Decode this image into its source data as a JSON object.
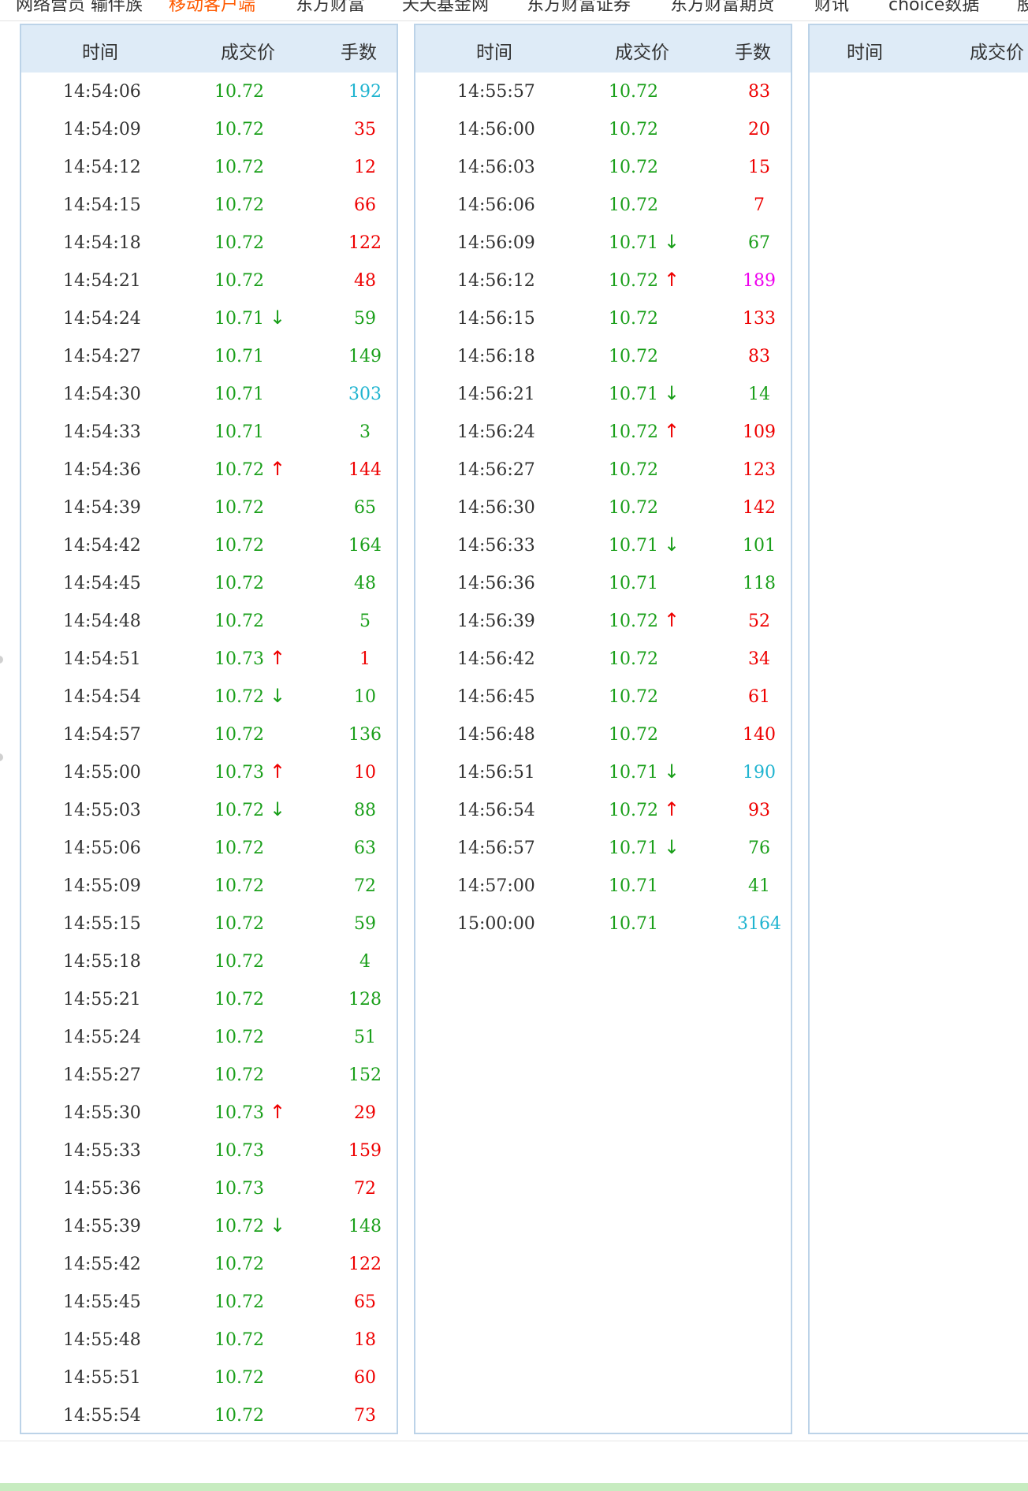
{
  "topnav": {
    "items": [
      "网络营员 输伴族",
      "移动客户端",
      "东方财富",
      "天天基金网",
      "东方财富证券",
      "东方财富期货",
      "财讯",
      "choice数据",
      "股"
    ]
  },
  "columns": {
    "time": "时间",
    "price": "成交价",
    "volume": "手数"
  },
  "colors": {
    "up": "#ee0000",
    "down": "#1a9f1a",
    "large": "#20b4d0",
    "huge": "#ee00ee",
    "header_bg": "#deebf7",
    "border": "#bcd3e8"
  },
  "panels": [
    {
      "rows": [
        {
          "time": "14:54:06",
          "price": "10.72",
          "arrow": "",
          "vol": "192",
          "vol_color": "cyan"
        },
        {
          "time": "14:54:09",
          "price": "10.72",
          "arrow": "",
          "vol": "35",
          "vol_color": "red"
        },
        {
          "time": "14:54:12",
          "price": "10.72",
          "arrow": "",
          "vol": "12",
          "vol_color": "red"
        },
        {
          "time": "14:54:15",
          "price": "10.72",
          "arrow": "",
          "vol": "66",
          "vol_color": "red"
        },
        {
          "time": "14:54:18",
          "price": "10.72",
          "arrow": "",
          "vol": "122",
          "vol_color": "red"
        },
        {
          "time": "14:54:21",
          "price": "10.72",
          "arrow": "",
          "vol": "48",
          "vol_color": "red"
        },
        {
          "time": "14:54:24",
          "price": "10.71",
          "arrow": "down",
          "vol": "59",
          "vol_color": "green"
        },
        {
          "time": "14:54:27",
          "price": "10.71",
          "arrow": "",
          "vol": "149",
          "vol_color": "green"
        },
        {
          "time": "14:54:30",
          "price": "10.71",
          "arrow": "",
          "vol": "303",
          "vol_color": "cyan"
        },
        {
          "time": "14:54:33",
          "price": "10.71",
          "arrow": "",
          "vol": "3",
          "vol_color": "green"
        },
        {
          "time": "14:54:36",
          "price": "10.72",
          "arrow": "up",
          "vol": "144",
          "vol_color": "red"
        },
        {
          "time": "14:54:39",
          "price": "10.72",
          "arrow": "",
          "vol": "65",
          "vol_color": "green"
        },
        {
          "time": "14:54:42",
          "price": "10.72",
          "arrow": "",
          "vol": "164",
          "vol_color": "green"
        },
        {
          "time": "14:54:45",
          "price": "10.72",
          "arrow": "",
          "vol": "48",
          "vol_color": "green"
        },
        {
          "time": "14:54:48",
          "price": "10.72",
          "arrow": "",
          "vol": "5",
          "vol_color": "green"
        },
        {
          "time": "14:54:51",
          "price": "10.73",
          "arrow": "up",
          "vol": "1",
          "vol_color": "red"
        },
        {
          "time": "14:54:54",
          "price": "10.72",
          "arrow": "down",
          "vol": "10",
          "vol_color": "green"
        },
        {
          "time": "14:54:57",
          "price": "10.72",
          "arrow": "",
          "vol": "136",
          "vol_color": "green"
        },
        {
          "time": "14:55:00",
          "price": "10.73",
          "arrow": "up",
          "vol": "10",
          "vol_color": "red"
        },
        {
          "time": "14:55:03",
          "price": "10.72",
          "arrow": "down",
          "vol": "88",
          "vol_color": "green"
        },
        {
          "time": "14:55:06",
          "price": "10.72",
          "arrow": "",
          "vol": "63",
          "vol_color": "green"
        },
        {
          "time": "14:55:09",
          "price": "10.72",
          "arrow": "",
          "vol": "72",
          "vol_color": "green"
        },
        {
          "time": "14:55:15",
          "price": "10.72",
          "arrow": "",
          "vol": "59",
          "vol_color": "green"
        },
        {
          "time": "14:55:18",
          "price": "10.72",
          "arrow": "",
          "vol": "4",
          "vol_color": "green"
        },
        {
          "time": "14:55:21",
          "price": "10.72",
          "arrow": "",
          "vol": "128",
          "vol_color": "green"
        },
        {
          "time": "14:55:24",
          "price": "10.72",
          "arrow": "",
          "vol": "51",
          "vol_color": "green"
        },
        {
          "time": "14:55:27",
          "price": "10.72",
          "arrow": "",
          "vol": "152",
          "vol_color": "green"
        },
        {
          "time": "14:55:30",
          "price": "10.73",
          "arrow": "up",
          "vol": "29",
          "vol_color": "red"
        },
        {
          "time": "14:55:33",
          "price": "10.73",
          "arrow": "",
          "vol": "159",
          "vol_color": "red"
        },
        {
          "time": "14:55:36",
          "price": "10.73",
          "arrow": "",
          "vol": "72",
          "vol_color": "red"
        },
        {
          "time": "14:55:39",
          "price": "10.72",
          "arrow": "down",
          "vol": "148",
          "vol_color": "green"
        },
        {
          "time": "14:55:42",
          "price": "10.72",
          "arrow": "",
          "vol": "122",
          "vol_color": "red"
        },
        {
          "time": "14:55:45",
          "price": "10.72",
          "arrow": "",
          "vol": "65",
          "vol_color": "red"
        },
        {
          "time": "14:55:48",
          "price": "10.72",
          "arrow": "",
          "vol": "18",
          "vol_color": "red"
        },
        {
          "time": "14:55:51",
          "price": "10.72",
          "arrow": "",
          "vol": "60",
          "vol_color": "red"
        },
        {
          "time": "14:55:54",
          "price": "10.72",
          "arrow": "",
          "vol": "73",
          "vol_color": "red"
        }
      ]
    },
    {
      "rows": [
        {
          "time": "14:55:57",
          "price": "10.72",
          "arrow": "",
          "vol": "83",
          "vol_color": "red"
        },
        {
          "time": "14:56:00",
          "price": "10.72",
          "arrow": "",
          "vol": "20",
          "vol_color": "red"
        },
        {
          "time": "14:56:03",
          "price": "10.72",
          "arrow": "",
          "vol": "15",
          "vol_color": "red"
        },
        {
          "time": "14:56:06",
          "price": "10.72",
          "arrow": "",
          "vol": "7",
          "vol_color": "red"
        },
        {
          "time": "14:56:09",
          "price": "10.71",
          "arrow": "down",
          "vol": "67",
          "vol_color": "green"
        },
        {
          "time": "14:56:12",
          "price": "10.72",
          "arrow": "up",
          "vol": "189",
          "vol_color": "magenta"
        },
        {
          "time": "14:56:15",
          "price": "10.72",
          "arrow": "",
          "vol": "133",
          "vol_color": "red"
        },
        {
          "time": "14:56:18",
          "price": "10.72",
          "arrow": "",
          "vol": "83",
          "vol_color": "red"
        },
        {
          "time": "14:56:21",
          "price": "10.71",
          "arrow": "down",
          "vol": "14",
          "vol_color": "green"
        },
        {
          "time": "14:56:24",
          "price": "10.72",
          "arrow": "up",
          "vol": "109",
          "vol_color": "red"
        },
        {
          "time": "14:56:27",
          "price": "10.72",
          "arrow": "",
          "vol": "123",
          "vol_color": "red"
        },
        {
          "time": "14:56:30",
          "price": "10.72",
          "arrow": "",
          "vol": "142",
          "vol_color": "red"
        },
        {
          "time": "14:56:33",
          "price": "10.71",
          "arrow": "down",
          "vol": "101",
          "vol_color": "green"
        },
        {
          "time": "14:56:36",
          "price": "10.71",
          "arrow": "",
          "vol": "118",
          "vol_color": "green"
        },
        {
          "time": "14:56:39",
          "price": "10.72",
          "arrow": "up",
          "vol": "52",
          "vol_color": "red"
        },
        {
          "time": "14:56:42",
          "price": "10.72",
          "arrow": "",
          "vol": "34",
          "vol_color": "red"
        },
        {
          "time": "14:56:45",
          "price": "10.72",
          "arrow": "",
          "vol": "61",
          "vol_color": "red"
        },
        {
          "time": "14:56:48",
          "price": "10.72",
          "arrow": "",
          "vol": "140",
          "vol_color": "red"
        },
        {
          "time": "14:56:51",
          "price": "10.71",
          "arrow": "down",
          "vol": "190",
          "vol_color": "cyan"
        },
        {
          "time": "14:56:54",
          "price": "10.72",
          "arrow": "up",
          "vol": "93",
          "vol_color": "red"
        },
        {
          "time": "14:56:57",
          "price": "10.71",
          "arrow": "down",
          "vol": "76",
          "vol_color": "green"
        },
        {
          "time": "14:57:00",
          "price": "10.71",
          "arrow": "",
          "vol": "41",
          "vol_color": "green"
        },
        {
          "time": "15:00:00",
          "price": "10.71",
          "arrow": "",
          "vol": "3164",
          "vol_color": "cyan"
        }
      ]
    },
    {
      "rows": []
    }
  ]
}
